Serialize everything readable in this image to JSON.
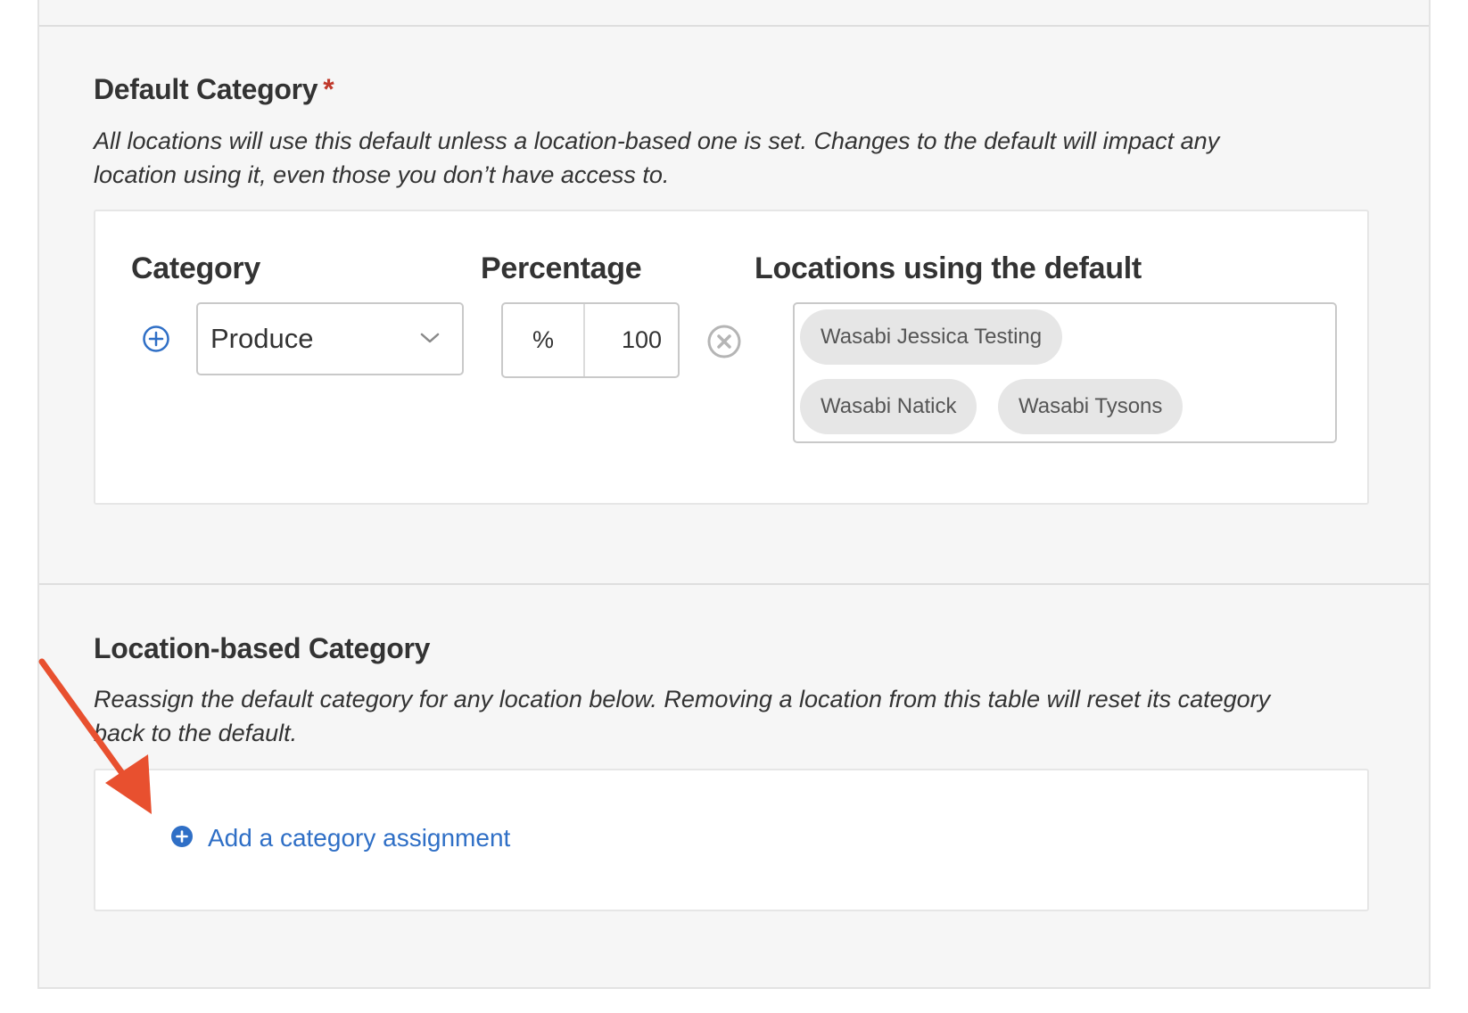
{
  "default_section": {
    "title": "Default Category",
    "required_marker": "*",
    "description_line1": "All locations will use this default unless a location-based one is set. Changes to the default will impact any",
    "description_line2": "location using it, even those you don’t have access to.",
    "columns": {
      "category": "Category",
      "percentage": "Percentage",
      "locations": "Locations using the default"
    },
    "row": {
      "category_value": "Produce",
      "percent_symbol": "%",
      "percent_value": "100",
      "locations": [
        "Wasabi Jessica Testing",
        "Wasabi Natick",
        "Wasabi Tysons"
      ]
    },
    "icons": {
      "add": "add-circle-icon",
      "remove": "remove-circle-icon",
      "dropdown": "chevron-down-icon"
    }
  },
  "location_section": {
    "title": "Location-based Category",
    "description_line1": "Reassign the default category for any location below. Removing a location from this table will reset its category",
    "description_line2": "back to the default.",
    "add_link_label": "Add a category assignment"
  },
  "colors": {
    "accent_blue": "#2f6fc6",
    "required_red": "#c0392b",
    "annotation_arrow": "#e8502f",
    "panel_bg": "#f6f6f6",
    "tag_bg": "#e6e6e6"
  }
}
